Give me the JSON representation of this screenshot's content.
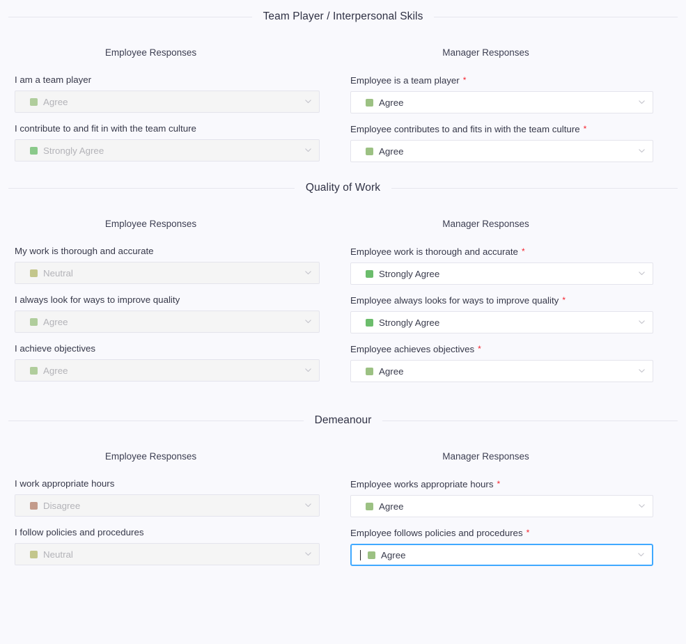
{
  "theme": {
    "page_bg": "#f9f9fd",
    "field_bg": "#ffffff",
    "field_bg_disabled": "#f5f5f5",
    "border": "#e4e4ec",
    "focus_border": "#40a9ff",
    "required_asterisk": "#f5222d",
    "divider": "#e6e6ee",
    "text": "#363849",
    "text_disabled": "#b3b3b8"
  },
  "answer_colors": {
    "Strongly Agree": "#6cbd6c",
    "Agree": "#9cc183",
    "Neutral": "#b5b86e",
    "Disagree": "#b5816d",
    "Strongly Disagree": "#b5556d"
  },
  "column_headers": {
    "employee": "Employee Responses",
    "manager": "Manager Responses"
  },
  "icons": {
    "chevron_down": "chevron-down-icon"
  },
  "sections": [
    {
      "id": "team-player",
      "title": "Team Player / Interpersonal Skils",
      "rows": [
        {
          "employee": {
            "label": "I am a team player",
            "value": "Agree",
            "required": false,
            "disabled": true,
            "focused": false
          },
          "manager": {
            "label": "Employee is a team player",
            "value": "Agree",
            "required": true,
            "disabled": false,
            "focused": false
          }
        },
        {
          "employee": {
            "label": "I contribute to and fit in with the team culture",
            "value": "Strongly Agree",
            "required": false,
            "disabled": true,
            "focused": false
          },
          "manager": {
            "label": "Employee contributes to and fits in with the team culture",
            "value": "Agree",
            "required": true,
            "disabled": false,
            "focused": false
          }
        }
      ]
    },
    {
      "id": "quality-of-work",
      "title": "Quality of Work",
      "rows": [
        {
          "employee": {
            "label": "My work is thorough and accurate",
            "value": "Neutral",
            "required": false,
            "disabled": true,
            "focused": false
          },
          "manager": {
            "label": "Employee work is thorough and accurate",
            "value": "Strongly Agree",
            "required": true,
            "disabled": false,
            "focused": false
          }
        },
        {
          "employee": {
            "label": "I always look for ways to improve quality",
            "value": "Agree",
            "required": false,
            "disabled": true,
            "focused": false
          },
          "manager": {
            "label": "Employee always looks for ways to improve quality",
            "value": "Strongly Agree",
            "required": true,
            "disabled": false,
            "focused": false
          }
        },
        {
          "employee": {
            "label": "I achieve objectives",
            "value": "Agree",
            "required": false,
            "disabled": true,
            "focused": false
          },
          "manager": {
            "label": "Employee achieves objectives",
            "value": "Agree",
            "required": true,
            "disabled": false,
            "focused": false
          }
        }
      ]
    },
    {
      "id": "demeanour",
      "title": "Demeanour",
      "rows": [
        {
          "employee": {
            "label": "I work appropriate hours",
            "value": "Disagree",
            "required": false,
            "disabled": true,
            "focused": false
          },
          "manager": {
            "label": "Employee works appropriate hours",
            "value": "Agree",
            "required": true,
            "disabled": false,
            "focused": false
          }
        },
        {
          "employee": {
            "label": "I follow policies and procedures",
            "value": "Neutral",
            "required": false,
            "disabled": true,
            "focused": false
          },
          "manager": {
            "label": "Employee follows policies and procedures",
            "value": "Agree",
            "required": true,
            "disabled": false,
            "focused": true
          }
        }
      ]
    }
  ]
}
